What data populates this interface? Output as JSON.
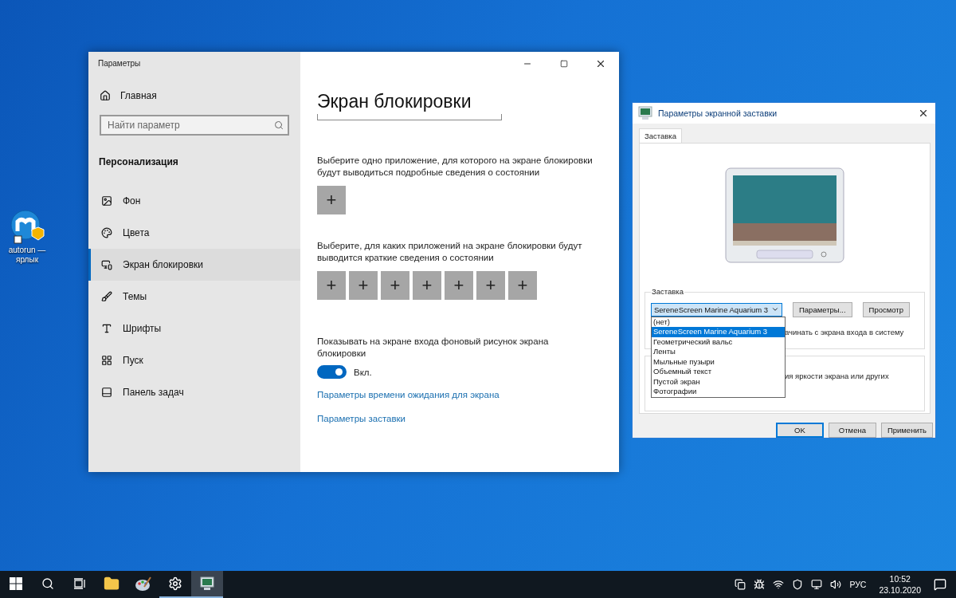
{
  "desktop_icons": [
    {
      "label": "autorun —\nярлык"
    }
  ],
  "settings_window": {
    "title": "Параметры",
    "home": "Главная",
    "search": {
      "placeholder": "Найти параметр"
    },
    "section": "Персонализация",
    "nav": [
      {
        "label": "Фон",
        "selected": false
      },
      {
        "label": "Цвета",
        "selected": false
      },
      {
        "label": "Экран блокировки",
        "selected": true
      },
      {
        "label": "Темы",
        "selected": false
      },
      {
        "label": "Шрифты",
        "selected": false
      },
      {
        "label": "Пуск",
        "selected": false
      },
      {
        "label": "Панель задач",
        "selected": false
      }
    ],
    "heading": "Экран блокировки",
    "detailed_text": "Выберите одно приложение, для которого на экране блокировки будут выводиться подробные сведения о состоянии",
    "detailed_slots": [
      "+"
    ],
    "quick_text": "Выберите, для каких приложений на экране блокировки будут выводится краткие сведения о состоянии",
    "quick_slots": [
      "+",
      "+",
      "+",
      "+",
      "+",
      "+",
      "+"
    ],
    "toggle_text": "Показывать на экране входа фоновый рисунок экрана блокировки",
    "toggle": {
      "on": true,
      "label": "Вкл."
    },
    "links": [
      "Параметры времени ожидания для экрана",
      "Параметры заставки"
    ]
  },
  "dialog": {
    "title": "Параметры экранной заставки",
    "tabs": [
      {
        "label": "Заставка",
        "selected": true
      }
    ],
    "group_title": "Заставка",
    "dropdown": {
      "value": "SereneScreen Marine Aquarium 3",
      "expanded": true
    },
    "group_buttons": [
      "Параметры...",
      "Просмотр"
    ],
    "options": [
      {
        "label": "(нет)",
        "selected": false
      },
      {
        "label": "SereneScreen Marine Aquarium 3",
        "selected": true
      },
      {
        "label": "Геометрический вальс",
        "selected": false
      },
      {
        "label": "Ленты",
        "selected": false
      },
      {
        "label": "Мыльные пузыри",
        "selected": false
      },
      {
        "label": "Объемный текст",
        "selected": false
      },
      {
        "label": "Пустой экран",
        "selected": false
      },
      {
        "label": "Фотографии",
        "selected": false
      }
    ],
    "partial_checkbox_text": "ачинать с экрана входа в систему",
    "partial_power_text": "ия яркости экрана или других",
    "buttons": [
      {
        "label": "OK",
        "default": true
      },
      {
        "label": "Отмена",
        "default": false
      },
      {
        "label": "Применить",
        "default": false
      }
    ]
  },
  "taskbar": {
    "apps": [
      {
        "running": false,
        "selected": false
      },
      {
        "running": false,
        "selected": false
      },
      {
        "running": true,
        "selected": false
      },
      {
        "running": true,
        "selected": true
      }
    ],
    "language": "РУС",
    "time": "10:52",
    "date": "23.10.2020"
  }
}
